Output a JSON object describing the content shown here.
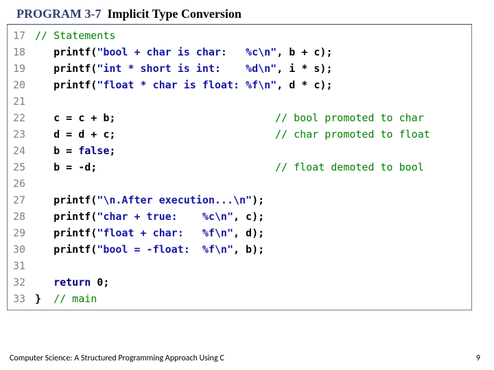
{
  "heading": {
    "label": "PROGRAM 3-7  ",
    "title": "Implicit Type Conversion"
  },
  "lines": [
    {
      "n": "17",
      "segs": [
        [
          "cmt",
          "// Statements"
        ]
      ]
    },
    {
      "n": "18",
      "segs": [
        [
          "txt",
          "   "
        ],
        [
          "fn",
          "printf"
        ],
        [
          "txt",
          "("
        ],
        [
          "str",
          "\"bool + char is char:   %c\\n\""
        ],
        [
          "txt",
          ", b + c);"
        ]
      ]
    },
    {
      "n": "19",
      "segs": [
        [
          "txt",
          "   "
        ],
        [
          "fn",
          "printf"
        ],
        [
          "txt",
          "("
        ],
        [
          "str",
          "\"int * short is int:    %d\\n\""
        ],
        [
          "txt",
          ", i * s);"
        ]
      ]
    },
    {
      "n": "20",
      "segs": [
        [
          "txt",
          "   "
        ],
        [
          "fn",
          "printf"
        ],
        [
          "txt",
          "("
        ],
        [
          "str",
          "\"float * char is float: %f\\n\""
        ],
        [
          "txt",
          ", d * c);"
        ]
      ]
    },
    {
      "n": "21",
      "segs": []
    },
    {
      "n": "22",
      "segs": [
        [
          "txt",
          "   c = c + b;"
        ]
      ],
      "midcmt": "// bool promoted to char"
    },
    {
      "n": "23",
      "segs": [
        [
          "txt",
          "   d = d + c;"
        ]
      ],
      "midcmt": "// char promoted to float"
    },
    {
      "n": "24",
      "segs": [
        [
          "txt",
          "   b = "
        ],
        [
          "kw",
          "false"
        ],
        [
          "txt",
          ";"
        ]
      ]
    },
    {
      "n": "25",
      "segs": [
        [
          "txt",
          "   b = -d;"
        ]
      ],
      "midcmt": "// float demoted to bool"
    },
    {
      "n": "26",
      "segs": []
    },
    {
      "n": "27",
      "segs": [
        [
          "txt",
          "   "
        ],
        [
          "fn",
          "printf"
        ],
        [
          "txt",
          "("
        ],
        [
          "str",
          "\"\\n.After execution...\\n\""
        ],
        [
          "txt",
          ");"
        ]
      ]
    },
    {
      "n": "28",
      "segs": [
        [
          "txt",
          "   "
        ],
        [
          "fn",
          "printf"
        ],
        [
          "txt",
          "("
        ],
        [
          "str",
          "\"char + true:    %c\\n\""
        ],
        [
          "txt",
          ", c);"
        ]
      ]
    },
    {
      "n": "29",
      "segs": [
        [
          "txt",
          "   "
        ],
        [
          "fn",
          "printf"
        ],
        [
          "txt",
          "("
        ],
        [
          "str",
          "\"float + char:   %f\\n\""
        ],
        [
          "txt",
          ", d);"
        ]
      ]
    },
    {
      "n": "30",
      "segs": [
        [
          "txt",
          "   "
        ],
        [
          "fn",
          "printf"
        ],
        [
          "txt",
          "("
        ],
        [
          "str",
          "\"bool = -float:  %f\\n\""
        ],
        [
          "txt",
          ", b);"
        ]
      ]
    },
    {
      "n": "31",
      "segs": []
    },
    {
      "n": "32",
      "segs": [
        [
          "txt",
          "   "
        ],
        [
          "kw",
          "return"
        ],
        [
          "txt",
          " 0;"
        ]
      ]
    },
    {
      "n": "33",
      "segs": [
        [
          "txt",
          "}  "
        ],
        [
          "cmt",
          "// main"
        ]
      ]
    }
  ],
  "footer": {
    "left": "Computer Science: A Structured Programming Approach Using C",
    "right": "9"
  }
}
